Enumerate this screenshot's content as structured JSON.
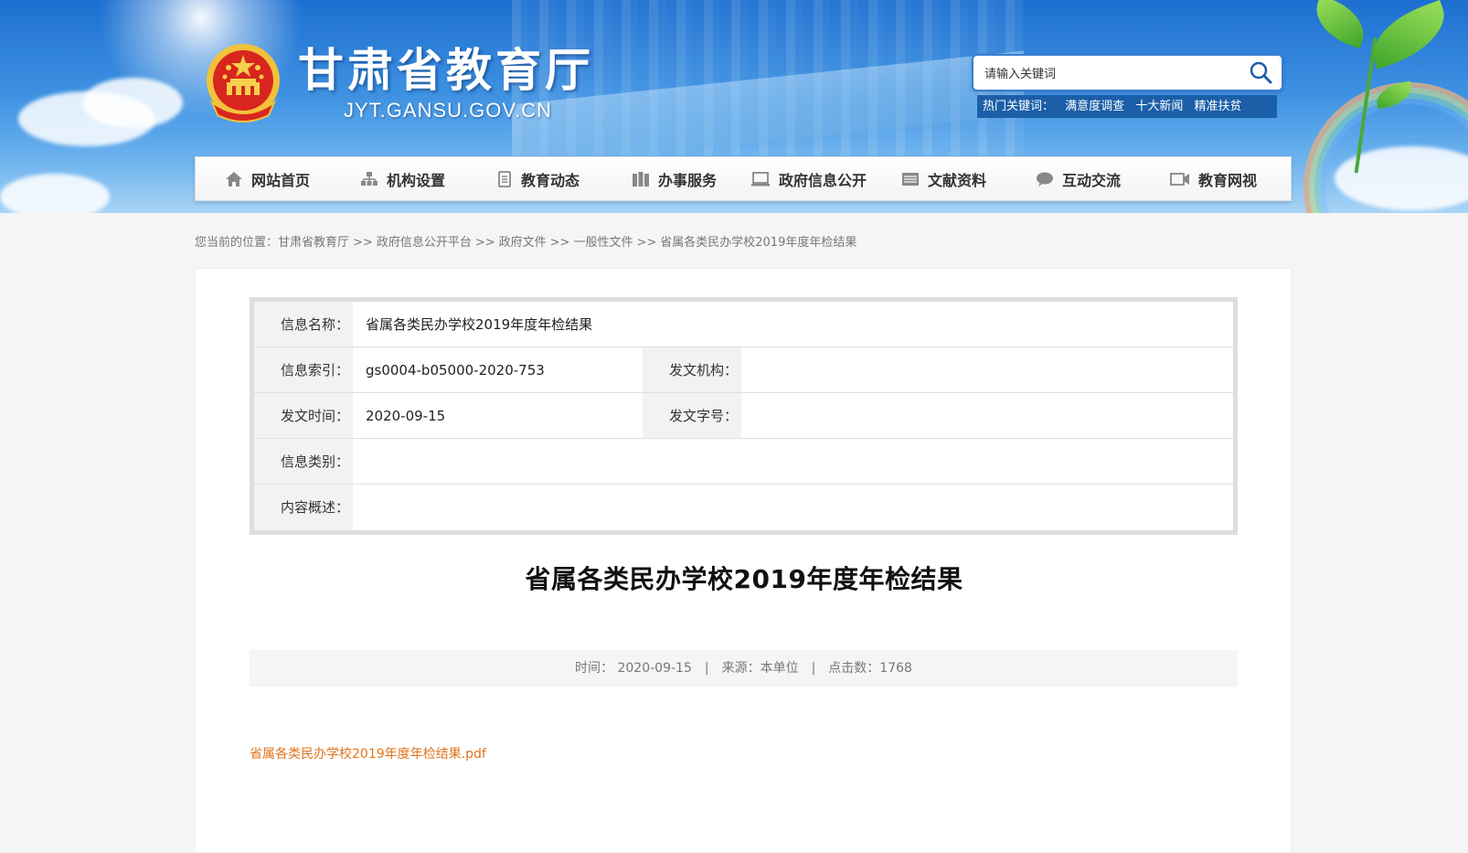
{
  "site": {
    "title": "甘肃省教育厅",
    "domain": "JYT.GANSU.GOV.CN"
  },
  "search": {
    "placeholder": "请输入关键词",
    "hot_label": "热门关键词：",
    "hot_keywords": [
      "满意度调查",
      "十大新闻",
      "精准扶贫"
    ]
  },
  "nav": {
    "items": [
      {
        "label": "网站首页",
        "icon": "home-icon"
      },
      {
        "label": "机构设置",
        "icon": "org-chart-icon"
      },
      {
        "label": "教育动态",
        "icon": "document-icon"
      },
      {
        "label": "办事服务",
        "icon": "services-icon"
      },
      {
        "label": "政府信息公开",
        "icon": "monitor-icon"
      },
      {
        "label": "文献资料",
        "icon": "archive-icon"
      },
      {
        "label": "互动交流",
        "icon": "chat-icon"
      },
      {
        "label": "教育网视",
        "icon": "video-icon"
      }
    ]
  },
  "breadcrumb": {
    "prefix": "您当前的位置：",
    "items": [
      "甘肃省教育厅",
      "政府信息公开平台",
      "政府文件",
      "一般性文件",
      "省属各类民办学校2019年度年检结果"
    ],
    "separator": ">>"
  },
  "info": {
    "name_label": "信息名称：",
    "name_value": "省属各类民办学校2019年度年检结果",
    "index_label": "信息索引：",
    "index_value": "gs0004-b05000-2020-753",
    "org_label": "发文机构：",
    "org_value": "",
    "date_label": "发文时间：",
    "date_value": "2020-09-15",
    "docno_label": "发文字号：",
    "docno_value": "",
    "category_label": "信息类别：",
    "category_value": "",
    "summary_label": "内容概述：",
    "summary_value": ""
  },
  "article": {
    "title": "省属各类民办学校2019年度年检结果",
    "meta_time": "时间： 2020-09-15",
    "meta_source": "来源：本单位",
    "meta_clicks": "点击数：1768",
    "meta_sep": "|",
    "attachment": "省属各类民办学校2019年度年检结果.pdf"
  },
  "colors": {
    "banner_blue": "#1d6fd0",
    "hot_bar": "#1b5fa8",
    "attachment_link": "#e0741c"
  }
}
